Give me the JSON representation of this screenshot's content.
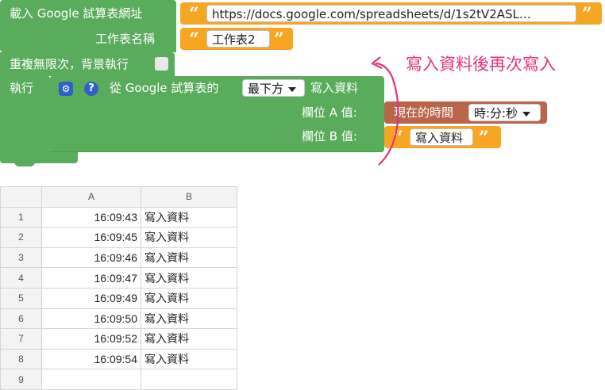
{
  "blocks": {
    "load_label": "載入 Google 試算表網址",
    "url_value": "https://docs.google.com/spreadsheets/d/1s2tV2ASL…",
    "sheet_name_label": "工作表名稱",
    "sheet_name_value": "工作表2",
    "repeat_label": "重複無限次，背景執行",
    "do_label": "執行",
    "from_label": "從 Google 試算表的",
    "position_value": "最下方",
    "write_label": "寫入資料",
    "field_a_label": "欄位 A 值:",
    "field_b_label": "欄位 B 值:",
    "time_label": "現在的時間",
    "time_format_value": "時:分:秒",
    "write_value": "寫入資料",
    "open_quote": "“",
    "close_quote": "”",
    "gear_glyph": "⚙",
    "help_glyph": "?"
  },
  "annotation": {
    "text": "寫入資料後再次寫入",
    "color": "#e6317a"
  },
  "colors": {
    "block_green": "#59ac5c",
    "text_orange": "#f7a623",
    "time_brown": "#b8654a",
    "icon_blue": "#2f62c9"
  },
  "sheet": {
    "columns": [
      "A",
      "B"
    ],
    "rows": [
      {
        "num": "1",
        "a": "16:09:43",
        "b": "寫入資料"
      },
      {
        "num": "2",
        "a": "16:09:45",
        "b": "寫入資料"
      },
      {
        "num": "3",
        "a": "16:09:46",
        "b": "寫入資料"
      },
      {
        "num": "4",
        "a": "16:09:47",
        "b": "寫入資料"
      },
      {
        "num": "5",
        "a": "16:09:49",
        "b": "寫入資料"
      },
      {
        "num": "6",
        "a": "16:09:50",
        "b": "寫入資料"
      },
      {
        "num": "7",
        "a": "16:09:52",
        "b": "寫入資料"
      },
      {
        "num": "8",
        "a": "16:09:54",
        "b": "寫入資料"
      },
      {
        "num": "9",
        "a": "",
        "b": ""
      }
    ]
  }
}
